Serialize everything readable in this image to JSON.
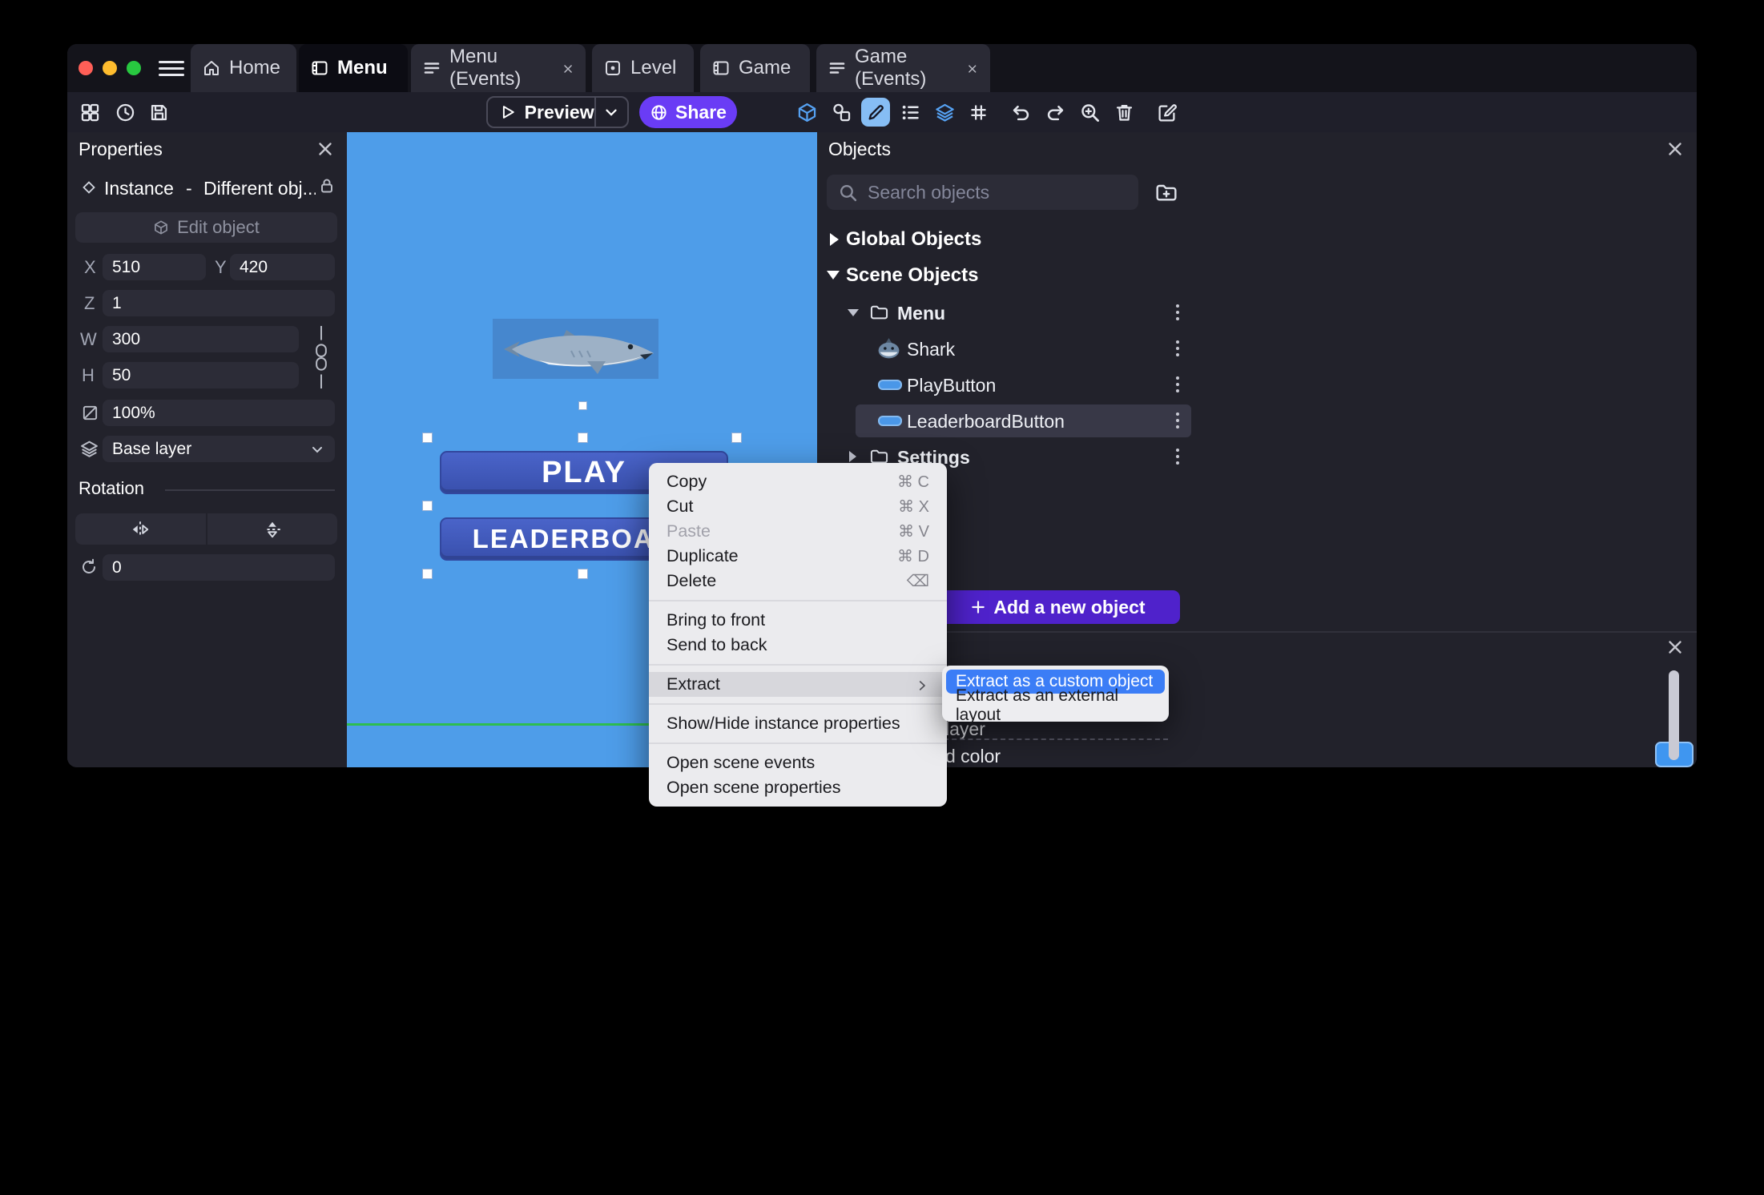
{
  "window": {
    "app": "GDevelop"
  },
  "tabs": [
    {
      "label": "Home",
      "icon": "home-icon",
      "active": false,
      "closable": false
    },
    {
      "label": "Menu",
      "icon": "scene-icon",
      "active": true,
      "closable": true
    },
    {
      "label": "Menu (Events)",
      "icon": "events-sheet-icon",
      "active": false,
      "closable": true
    },
    {
      "label": "Level",
      "icon": "scene-icon",
      "active": false,
      "closable": true
    },
    {
      "label": "Game",
      "icon": "scene-icon",
      "active": false,
      "closable": true
    },
    {
      "label": "Game (Events)",
      "icon": "events-sheet-icon",
      "active": false,
      "closable": true
    }
  ],
  "toolbar": {
    "preview_label": "Preview",
    "share_label": "Share",
    "left_icons": [
      "project-manager-icon",
      "history-icon",
      "save-icon"
    ],
    "right_icons": [
      "3d-box-icon",
      "objects-groups-icon",
      "pencil-tool-icon",
      "instances-list-icon",
      "layers-icon",
      "grid-icon",
      "undo-icon",
      "redo-icon",
      "zoom-icon",
      "trash-icon",
      "rename-icon"
    ]
  },
  "properties_panel": {
    "title": "Properties",
    "instance_label": "Instance",
    "separator": "-",
    "object_name": "Different obj...",
    "edit_object_label": "Edit object",
    "x_label": "X",
    "x_value": "510",
    "y_label": "Y",
    "y_value": "420",
    "z_label": "Z",
    "z_value": "1",
    "w_label": "W",
    "w_value": "300",
    "h_label": "H",
    "h_value": "50",
    "opacity_value": "100%",
    "layer_value": "Base layer",
    "rotation_title": "Rotation",
    "rotation_value": "0"
  },
  "canvas": {
    "play_button_label": "PLAY",
    "leaderboard_button_label": "LEADERBOARD"
  },
  "context_menu": {
    "items": [
      {
        "label": "Copy",
        "shortcut": "⌘ C"
      },
      {
        "label": "Cut",
        "shortcut": "⌘ X"
      },
      {
        "label": "Paste",
        "shortcut": "⌘ V",
        "disabled": true
      },
      {
        "label": "Duplicate",
        "shortcut": "⌘ D"
      },
      {
        "label": "Delete",
        "shortcut": "⌫"
      },
      {
        "label": "Bring to front"
      },
      {
        "label": "Send to back"
      },
      {
        "label": "Extract",
        "has_submenu": true,
        "highlighted": true
      },
      {
        "label": "Show/Hide instance properties"
      },
      {
        "label": "Open scene events"
      },
      {
        "label": "Open scene properties"
      }
    ]
  },
  "extract_submenu": {
    "items": [
      {
        "label": "Extract as a custom object",
        "highlighted": true
      },
      {
        "label": "Extract as an external layout",
        "highlighted": false
      }
    ]
  },
  "objects_panel": {
    "title": "Objects",
    "search_placeholder": "Search objects",
    "sections": {
      "global": "Global Objects",
      "scene": "Scene Objects"
    },
    "tree": {
      "menu_folder_label": "Menu",
      "menu_children": [
        {
          "label": "Shark",
          "icon": "shark-icon",
          "selected": false
        },
        {
          "label": "PlayButton",
          "icon": "button-icon",
          "selected": false
        },
        {
          "label": "LeaderboardButton",
          "icon": "button-icon",
          "selected": true
        }
      ],
      "settings_folder_label": "Settings"
    },
    "add_object_label": "Add a new object",
    "bottom_fragments": {
      "layer_text": "layer",
      "color_text": "d color"
    }
  },
  "colors": {
    "canvas": "#4e9de9",
    "accent_purple": "#6a3cf5",
    "add_button_purple": "#4f22cb",
    "selection_row": "#383847",
    "submenu_highlight": "#3b7df6",
    "green_guide": "#2ebd4f",
    "color_swatch": "#3f96f0"
  }
}
